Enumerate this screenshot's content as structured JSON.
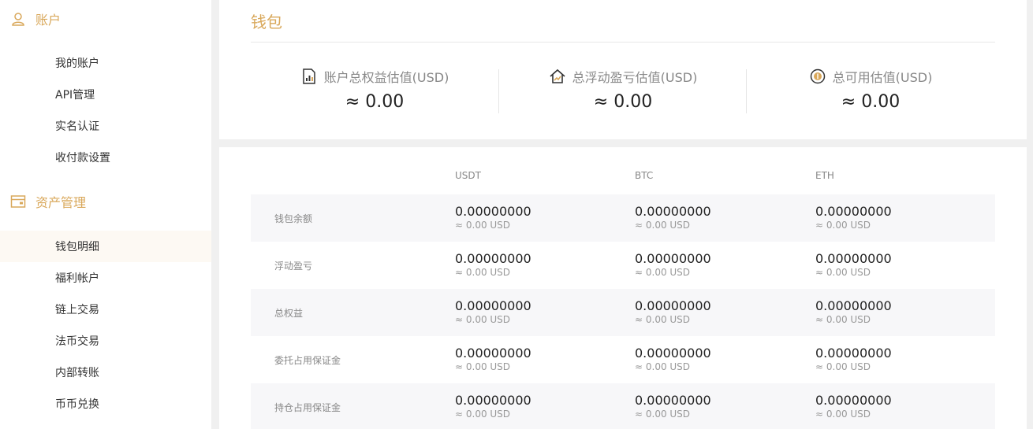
{
  "sidebar": {
    "account_section": {
      "title": "账户",
      "icon": "user-icon"
    },
    "account_items": [
      "我的账户",
      "API管理",
      "实名认证",
      "收付款设置"
    ],
    "assets_section": {
      "title": "资产管理",
      "icon": "wallet-icon"
    },
    "assets_items": [
      "钱包明细",
      "福利帐户",
      "链上交易",
      "法币交易",
      "内部转账",
      "币币兑换"
    ],
    "active_item": "钱包明细"
  },
  "wallet": {
    "title": "钱包",
    "stats": [
      {
        "label": "账户总权益估值(USD)",
        "value": "≈ 0.00",
        "icon": "document-chart-icon"
      },
      {
        "label": "总浮动盈亏估值(USD)",
        "value": "≈ 0.00",
        "icon": "house-chart-icon"
      },
      {
        "label": "总可用估值(USD)",
        "value": "≈ 0.00",
        "icon": "coin-icon"
      }
    ]
  },
  "table": {
    "columns": [
      "USDT",
      "BTC",
      "ETH"
    ],
    "rows": [
      {
        "name": "钱包余额",
        "cells": [
          {
            "amount": "0.00000000",
            "usd": "≈ 0.00 USD"
          },
          {
            "amount": "0.00000000",
            "usd": "≈ 0.00 USD"
          },
          {
            "amount": "0.00000000",
            "usd": "≈ 0.00 USD"
          }
        ]
      },
      {
        "name": "浮动盈亏",
        "cells": [
          {
            "amount": "0.00000000",
            "usd": "≈ 0.00 USD"
          },
          {
            "amount": "0.00000000",
            "usd": "≈ 0.00 USD"
          },
          {
            "amount": "0.00000000",
            "usd": "≈ 0.00 USD"
          }
        ]
      },
      {
        "name": "总权益",
        "cells": [
          {
            "amount": "0.00000000",
            "usd": "≈ 0.00 USD"
          },
          {
            "amount": "0.00000000",
            "usd": "≈ 0.00 USD"
          },
          {
            "amount": "0.00000000",
            "usd": "≈ 0.00 USD"
          }
        ]
      },
      {
        "name": "委托占用保证金",
        "cells": [
          {
            "amount": "0.00000000",
            "usd": "≈ 0.00 USD"
          },
          {
            "amount": "0.00000000",
            "usd": "≈ 0.00 USD"
          },
          {
            "amount": "0.00000000",
            "usd": "≈ 0.00 USD"
          }
        ]
      },
      {
        "name": "持仓占用保证金",
        "cells": [
          {
            "amount": "0.00000000",
            "usd": "≈ 0.00 USD"
          },
          {
            "amount": "0.00000000",
            "usd": "≈ 0.00 USD"
          },
          {
            "amount": "0.00000000",
            "usd": "≈ 0.00 USD"
          }
        ]
      }
    ]
  },
  "colors": {
    "accent": "#d9a85b",
    "active_bg": "#fdf9f3",
    "row_shade": "#f7f7f9"
  }
}
